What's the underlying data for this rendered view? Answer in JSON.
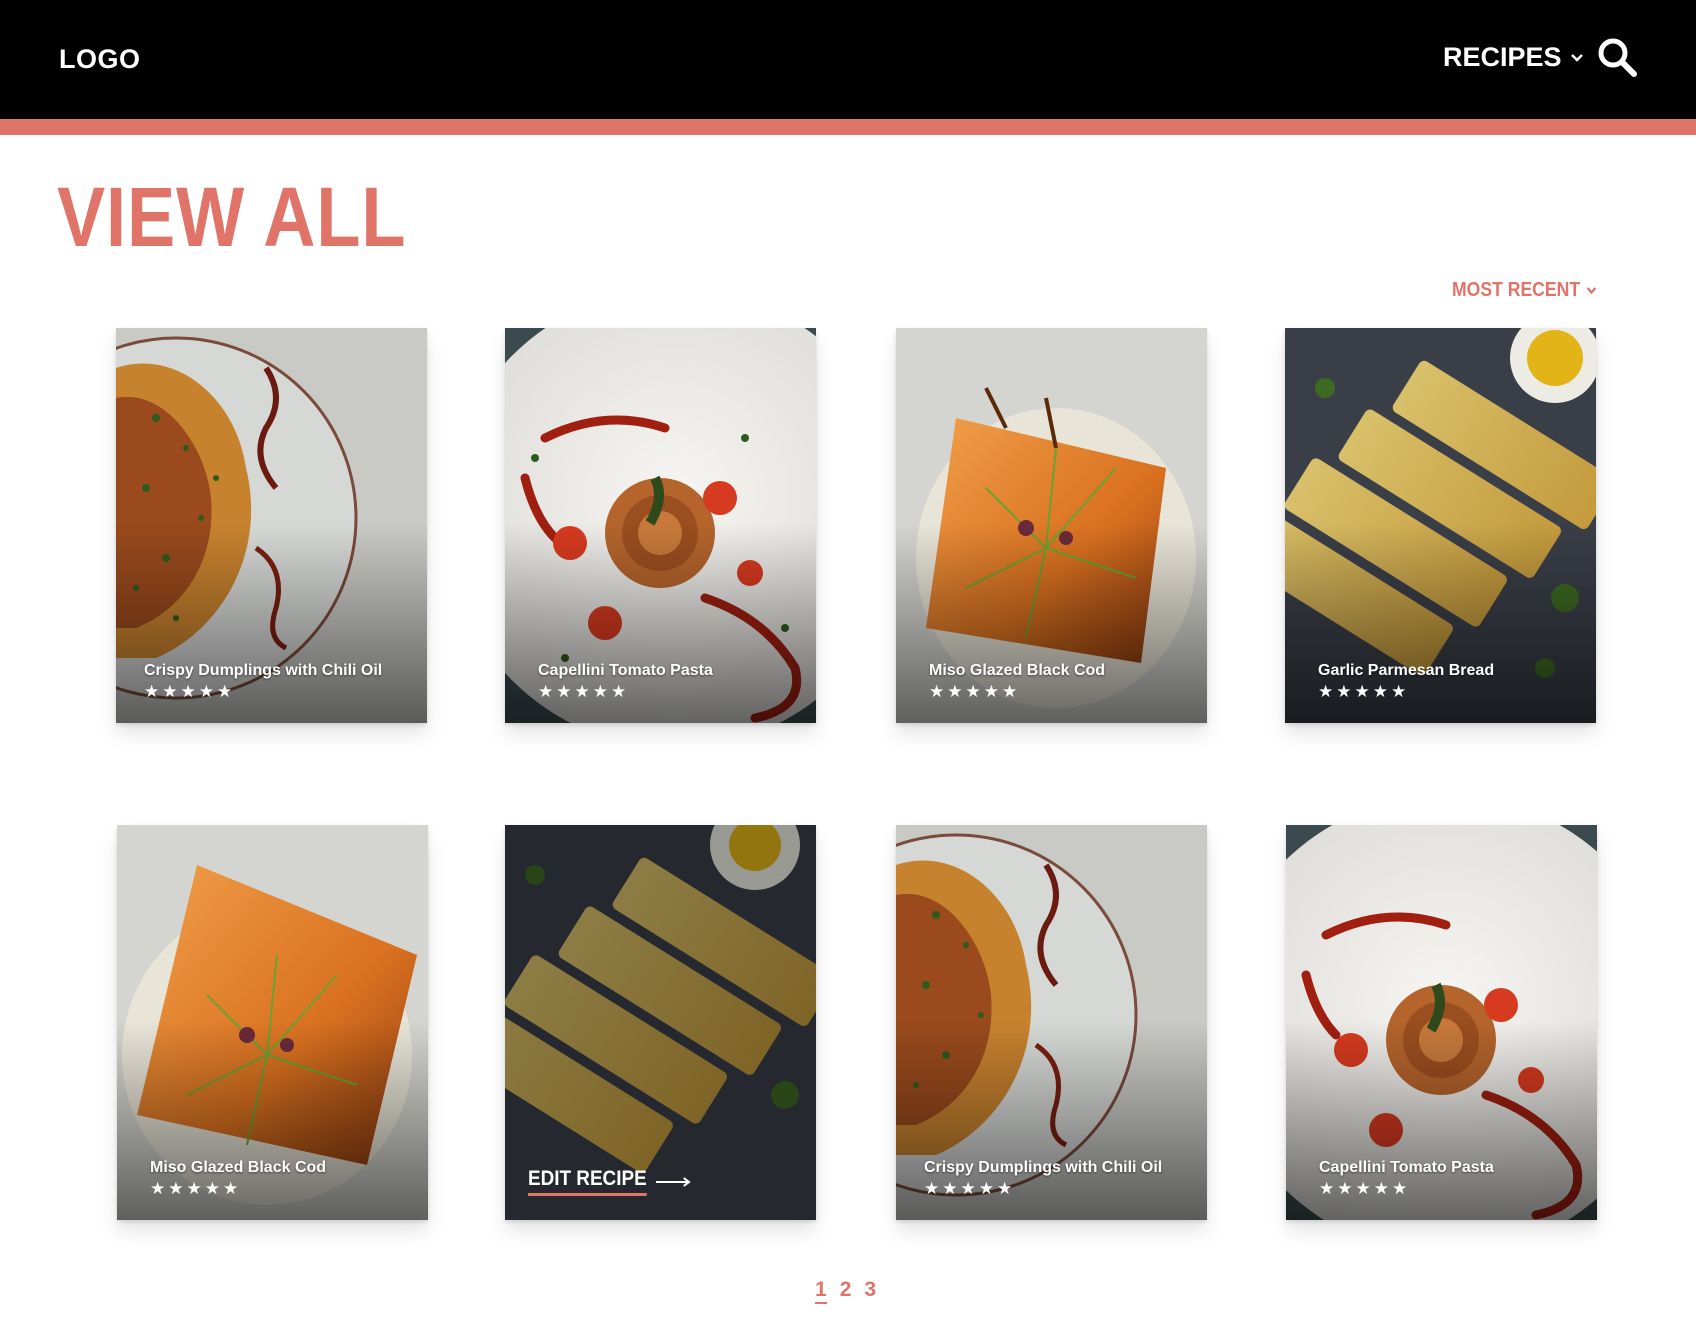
{
  "header": {
    "logo": "LOGO",
    "nav_recipes": "RECIPES",
    "search_icon": "search-icon",
    "accent_color": "#e07468"
  },
  "page": {
    "title": "VIEW ALL",
    "sort_label": "MOST RECENT"
  },
  "cards": [
    {
      "name": "Crispy Dumplings with Chili Oil",
      "stars": "★★★★★",
      "image": "dumplings"
    },
    {
      "name": "Capellini Tomato Pasta",
      "stars": "★★★★★",
      "image": "pasta"
    },
    {
      "name": "Miso Glazed Black Cod",
      "stars": "★★★★★",
      "image": "cod"
    },
    {
      "name": "Garlic Parmesan Bread",
      "stars": "★★★★★",
      "image": "bread"
    },
    {
      "name": "Miso Glazed Black Cod",
      "stars": "★★★★★",
      "image": "cod"
    },
    {
      "edit_label": "EDIT RECIPE",
      "image": "bread",
      "state": "hover"
    },
    {
      "name": "Crispy Dumplings with Chili Oil",
      "stars": "★★★★★",
      "image": "dumplings"
    },
    {
      "name": "Capellini Tomato Pasta",
      "stars": "★★★★★",
      "image": "pasta"
    }
  ],
  "pagination": {
    "pages": [
      "1",
      "2",
      "3"
    ],
    "current": "1"
  }
}
